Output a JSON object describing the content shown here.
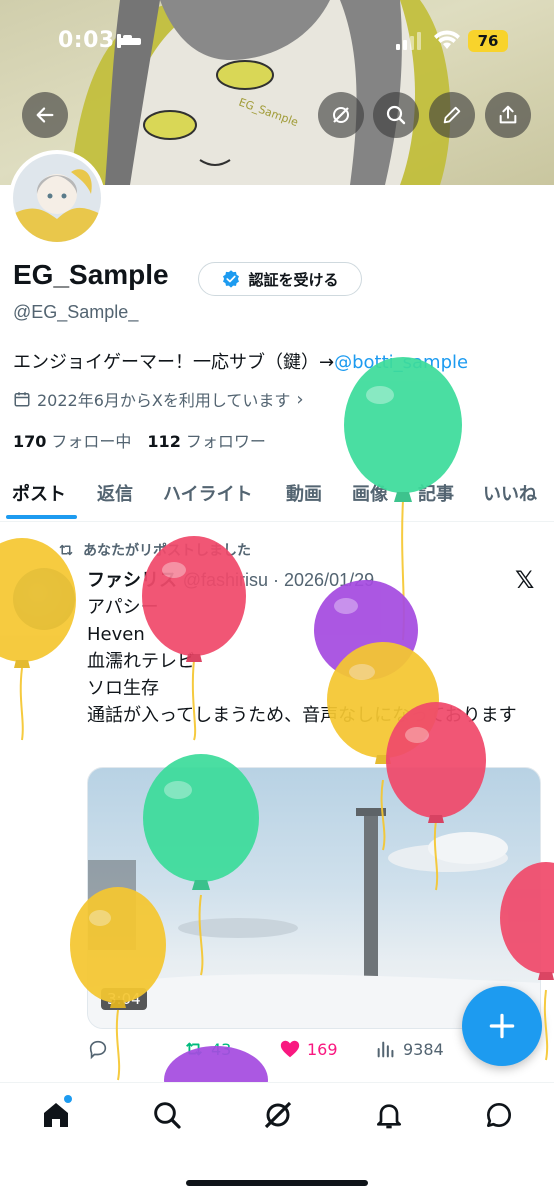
{
  "status_bar": {
    "time": "0:03",
    "battery": "76"
  },
  "header": {
    "back_icon": "arrow-left-icon",
    "grok_icon": "grok-icon",
    "search_icon": "search-icon",
    "compose_icon": "pencil-icon",
    "share_icon": "share-icon"
  },
  "profile": {
    "name": "EG_Sample",
    "verify_label": "認証を受ける",
    "handle": "@EG_Sample_",
    "bio_text": "エンジョイゲーマー！一応サブ（鍵）→",
    "bio_link": "@botti_sample",
    "joined": "2022年6月からXを利用しています",
    "following_count": "170",
    "following_label": "フォロー中",
    "followers_count": "112",
    "followers_label": "フォロワー"
  },
  "tabs": [
    {
      "label": "ポスト"
    },
    {
      "label": "返信"
    },
    {
      "label": "ハイライト"
    },
    {
      "label": "動画"
    },
    {
      "label": "画像"
    },
    {
      "label": "記事"
    },
    {
      "label": "いいね"
    }
  ],
  "tweet": {
    "repost_label": "あなたがリポストしました",
    "author_name": "ファシリス",
    "author_meta": "@fashirisu · 2026/01/29",
    "lines": [
      "アパシー",
      "Heven",
      "血濡れテレビ",
      "ソロ生存",
      "通話が入ってしまうため、音声なしになっております"
    ],
    "video_duration": "3:04",
    "retweets": "43",
    "likes": "169",
    "views": "9384"
  },
  "colors": {
    "accent": "#1d9bf0",
    "like": "#f91880",
    "retweet": "#00ba7c",
    "balloon_green": "#3ddc9b",
    "balloon_pink": "#f04a6b",
    "balloon_yellow": "#f5c731",
    "balloon_purple": "#a54be0"
  },
  "bottom_nav": [
    "home-icon",
    "search-icon",
    "grok-icon",
    "bell-icon",
    "messages-icon"
  ]
}
